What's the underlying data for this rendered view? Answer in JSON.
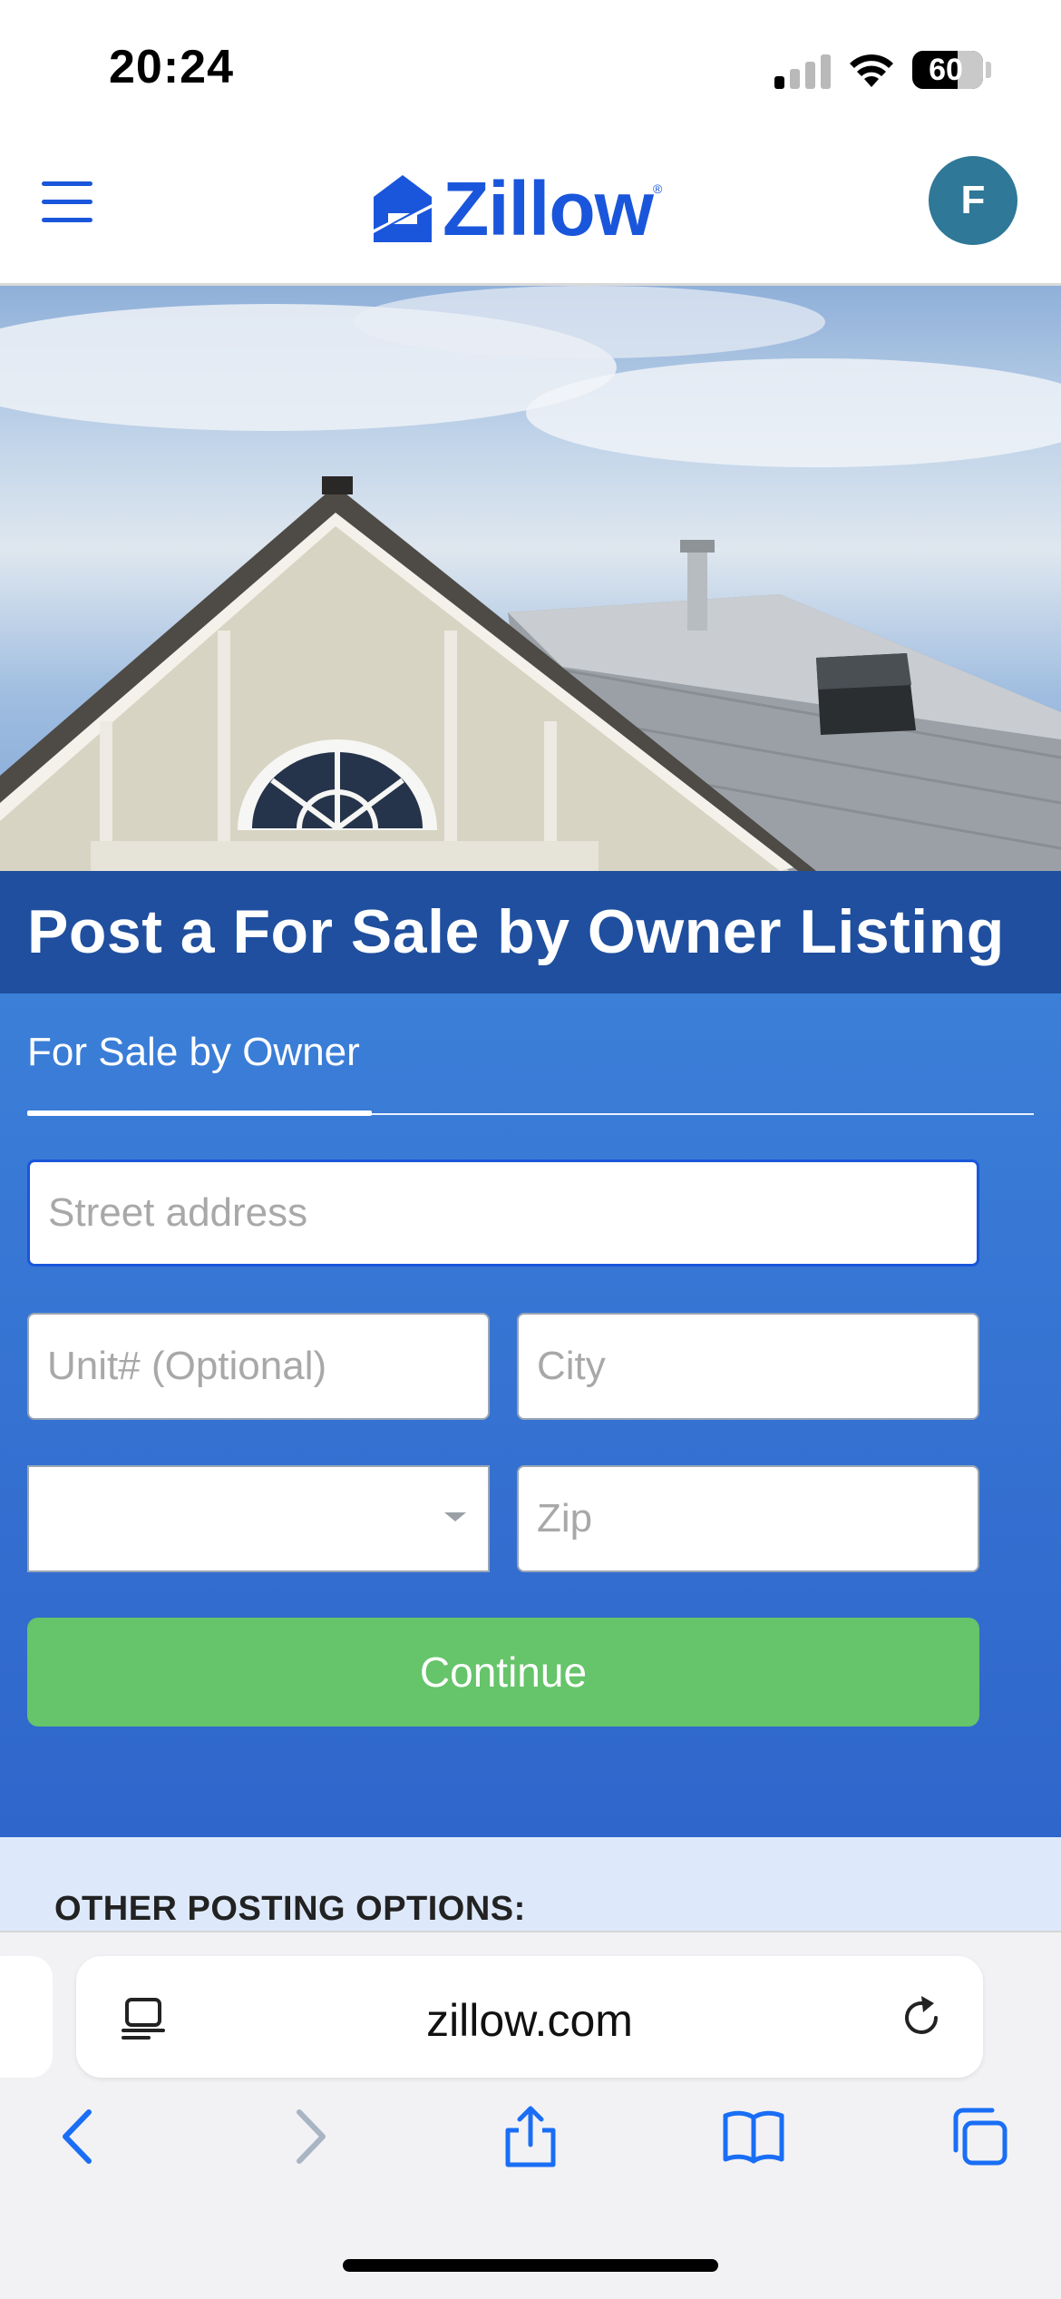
{
  "status_bar": {
    "time": "20:24",
    "battery": "60"
  },
  "header": {
    "logo_text": "Zillow",
    "avatar_initial": "F"
  },
  "page": {
    "title": "Post a For Sale by Owner Listing",
    "tab_label": "For Sale by Owner"
  },
  "form": {
    "street_placeholder": "Street address",
    "unit_placeholder": "Unit# (Optional)",
    "city_placeholder": "City",
    "state_value": "",
    "zip_placeholder": "Zip",
    "continue_label": "Continue"
  },
  "other_options": {
    "heading": "OTHER POSTING OPTIONS:"
  },
  "browser": {
    "url": "zillow.com"
  },
  "colors": {
    "brand": "#1a56db",
    "title_band": "#1f4f9e",
    "continue": "#66c46a",
    "avatar": "#2f7897"
  }
}
